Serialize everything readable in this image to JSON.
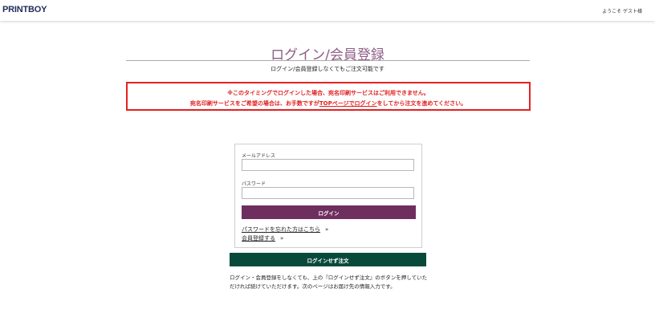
{
  "header": {
    "logo": "PRINTBOY",
    "welcome": "ようこそ ゲスト様"
  },
  "page": {
    "title": "ログイン/会員登録",
    "subtitle": "ログイン/会員登録しなくてもご注文可能です"
  },
  "notice": {
    "line1": "※このタイミングでログインした場合、宛名印刷サービスはご利用できません。",
    "line2_prefix": "宛名印刷サービスをご希望の場合は、お手数ですが",
    "line2_link1": "TOPページでログイン",
    "line2_suffix": "をしてから注文を進めてください。",
    "color": "#e11d1d"
  },
  "login_form": {
    "email_label": "メールアドレス",
    "email_value": "",
    "password_label": "パスワード",
    "password_value": "",
    "login_button": "ログイン",
    "login_button_color": "#6e2f5f",
    "forgot_link": "パスワードを忘れた方はこちら",
    "register_link": "会員登録する",
    "arrow": "»"
  },
  "guest": {
    "button": "ログインせず注文",
    "button_color": "#074a3b",
    "note": "ログイン・会員登録をしなくても、上の『ログインせず注文』のボタンを押していただければ続けていただけます。次のページはお届け先の情報入力です。"
  }
}
